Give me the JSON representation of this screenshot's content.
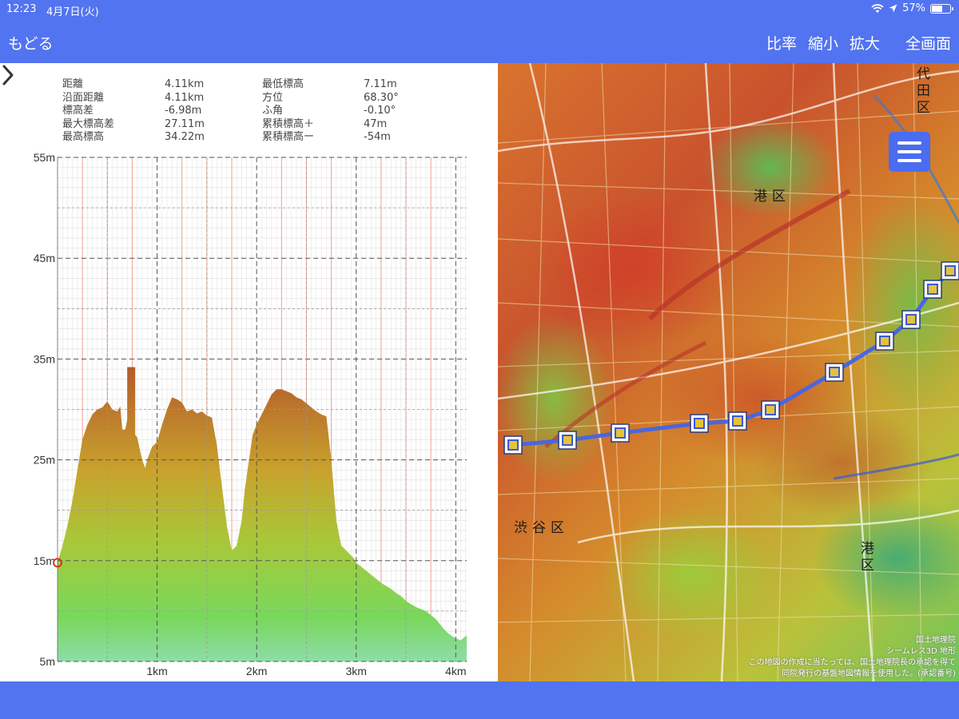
{
  "status": {
    "time": "12:23",
    "date": "4月7日(火)",
    "battery": "57%",
    "battery_level": 0.57
  },
  "nav": {
    "back_label": "もどる",
    "scale_label": "比率",
    "zoom_out_label": "縮小",
    "zoom_in_label": "拡大",
    "fullscreen_label": "全画面"
  },
  "stats": {
    "col1_labels": [
      "距離",
      "沿面距離",
      "標高差",
      "最大標高差",
      "最高標高"
    ],
    "col1_values": [
      "4.11km",
      "4.11km",
      "-6.98m",
      "27.11m",
      "34.22m"
    ],
    "col2_labels": [
      "最低標高",
      "方位",
      "ふ角",
      "累積標高＋",
      "累積標高ー"
    ],
    "col2_values": [
      "7.11m",
      "68.30°",
      "-0.10°",
      "47m",
      "-54m"
    ]
  },
  "chart_data": {
    "type": "area",
    "xlabel": "",
    "ylabel": "",
    "xlim": [
      0,
      4.11
    ],
    "ylim": [
      5,
      55
    ],
    "x_ticks": [
      {
        "value": 1,
        "label": "1km"
      },
      {
        "value": 2,
        "label": "2km"
      },
      {
        "value": 3,
        "label": "3km"
      },
      {
        "value": 4,
        "label": "4km"
      }
    ],
    "y_ticks": [
      {
        "value": 55,
        "label": "55m"
      },
      {
        "value": 45,
        "label": "45m"
      },
      {
        "value": 35,
        "label": "35m"
      },
      {
        "value": 25,
        "label": "25m"
      },
      {
        "value": 15,
        "label": "15m"
      },
      {
        "value": 5,
        "label": "5m"
      }
    ],
    "grid": true,
    "series": [
      {
        "x": [
          0,
          0.05,
          0.1,
          0.15,
          0.2,
          0.25,
          0.3,
          0.35,
          0.4,
          0.45,
          0.5,
          0.55,
          0.6,
          0.63,
          0.65,
          0.68,
          0.7,
          0.7,
          0.78,
          0.78,
          0.8,
          0.85,
          0.88,
          0.9,
          0.95,
          1.0,
          1.05,
          1.1,
          1.15,
          1.2,
          1.25,
          1.3,
          1.35,
          1.4,
          1.45,
          1.5,
          1.55,
          1.6,
          1.65,
          1.7,
          1.75,
          1.8,
          1.85,
          1.88,
          1.92,
          1.96,
          2.0,
          2.05,
          2.1,
          2.15,
          2.2,
          2.25,
          2.3,
          2.35,
          2.4,
          2.45,
          2.5,
          2.55,
          2.6,
          2.65,
          2.7,
          2.75,
          2.8,
          2.85,
          2.9,
          2.95,
          2.98,
          3.0,
          3.05,
          3.1,
          3.15,
          3.2,
          3.25,
          3.3,
          3.35,
          3.4,
          3.45,
          3.5,
          3.55,
          3.6,
          3.65,
          3.7,
          3.75,
          3.8,
          3.85,
          3.9,
          3.95,
          4.0,
          4.05,
          4.11
        ],
        "y": [
          14.8,
          16.5,
          18.5,
          21,
          24,
          27,
          28.5,
          29.5,
          30,
          30.2,
          30.8,
          30,
          29.8,
          30.3,
          28,
          28,
          29,
          34.2,
          34.2,
          27.5,
          27.2,
          25,
          24.2,
          25,
          26.3,
          26.8,
          28.5,
          30,
          31.2,
          31,
          30.7,
          29.8,
          30,
          29.6,
          29.8,
          29.4,
          29.2,
          26.5,
          22.5,
          18.5,
          16,
          16.5,
          19,
          22,
          24.8,
          27.5,
          28.5,
          29.5,
          30.5,
          31.5,
          32,
          32,
          31.8,
          31.6,
          31.2,
          31,
          30.6,
          30.2,
          29.8,
          29.5,
          29.3,
          25,
          19,
          16.5,
          16,
          15.5,
          15.2,
          14.8,
          14.4,
          14,
          13.6,
          13.2,
          12.8,
          12.5,
          12.2,
          11.8,
          11.5,
          11,
          10.7,
          10.4,
          10.2,
          10,
          9.6,
          9.2,
          8.6,
          8.0,
          7.6,
          7.3,
          7.1,
          7.6
        ]
      }
    ]
  },
  "map": {
    "labels": {
      "minato1": "港区",
      "shibuya": "渋谷区",
      "minato2": "港区",
      "chiyoda": "代田区"
    },
    "attribution": [
      "国土地理院",
      "シームレス3D  地形",
      "この地図の作成に当たっては、国土地理院長の承認を得て",
      "同院発行の基盤地図情報を使用した。(承認番号)"
    ],
    "menu_icon": "hamburger-menu-icon",
    "route_color": "#4a66e0",
    "marker_count": 13
  },
  "colors": {
    "header": "#5274f0",
    "area_top": "#b45a2c",
    "area_bottom": "#8edca8",
    "start_marker": "#d23a1e"
  }
}
